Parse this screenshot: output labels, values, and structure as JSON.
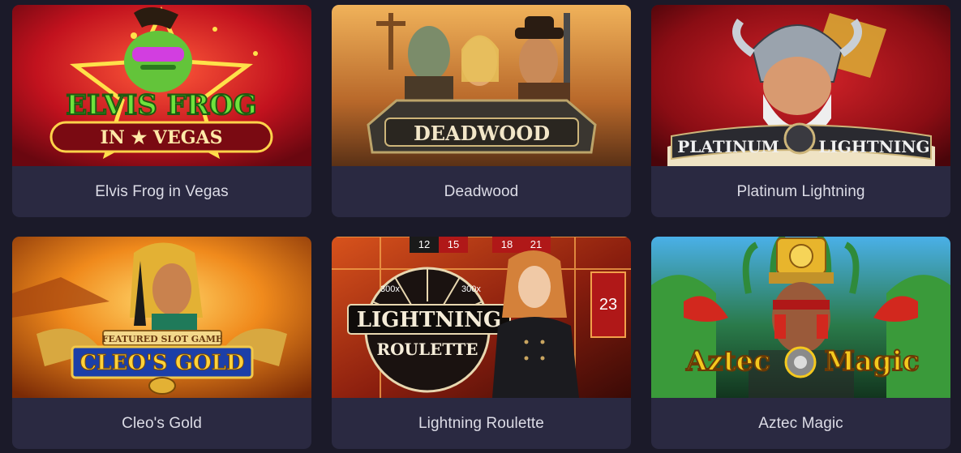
{
  "games": [
    {
      "id": "elvis-frog",
      "title": "Elvis Frog in Vegas",
      "logo_line1": "ELVIS FROG",
      "logo_line2": "IN ★ VEGAS"
    },
    {
      "id": "deadwood",
      "title": "Deadwood",
      "logo_line1": "DEADWOOD"
    },
    {
      "id": "platinum-lightning",
      "title": "Platinum Lightning",
      "logo_line1": "PLATINUM",
      "logo_line2": "LIGHTNING"
    },
    {
      "id": "cleos-gold",
      "title": "Cleo's Gold",
      "logo_line1": "FEATURED SLOT GAME",
      "logo_line2": "CLEO'S GOLD"
    },
    {
      "id": "lightning-roulette",
      "title": "Lightning Roulette",
      "logo_line1": "LIGHTNING",
      "logo_line2": "ROULETTE",
      "multiplier": "300x",
      "numbers": [
        "12",
        "15",
        "18",
        "21",
        "23"
      ]
    },
    {
      "id": "aztec-magic",
      "title": "Aztec Magic",
      "logo_line1": "Aztec",
      "logo_line2": "Magic"
    }
  ]
}
